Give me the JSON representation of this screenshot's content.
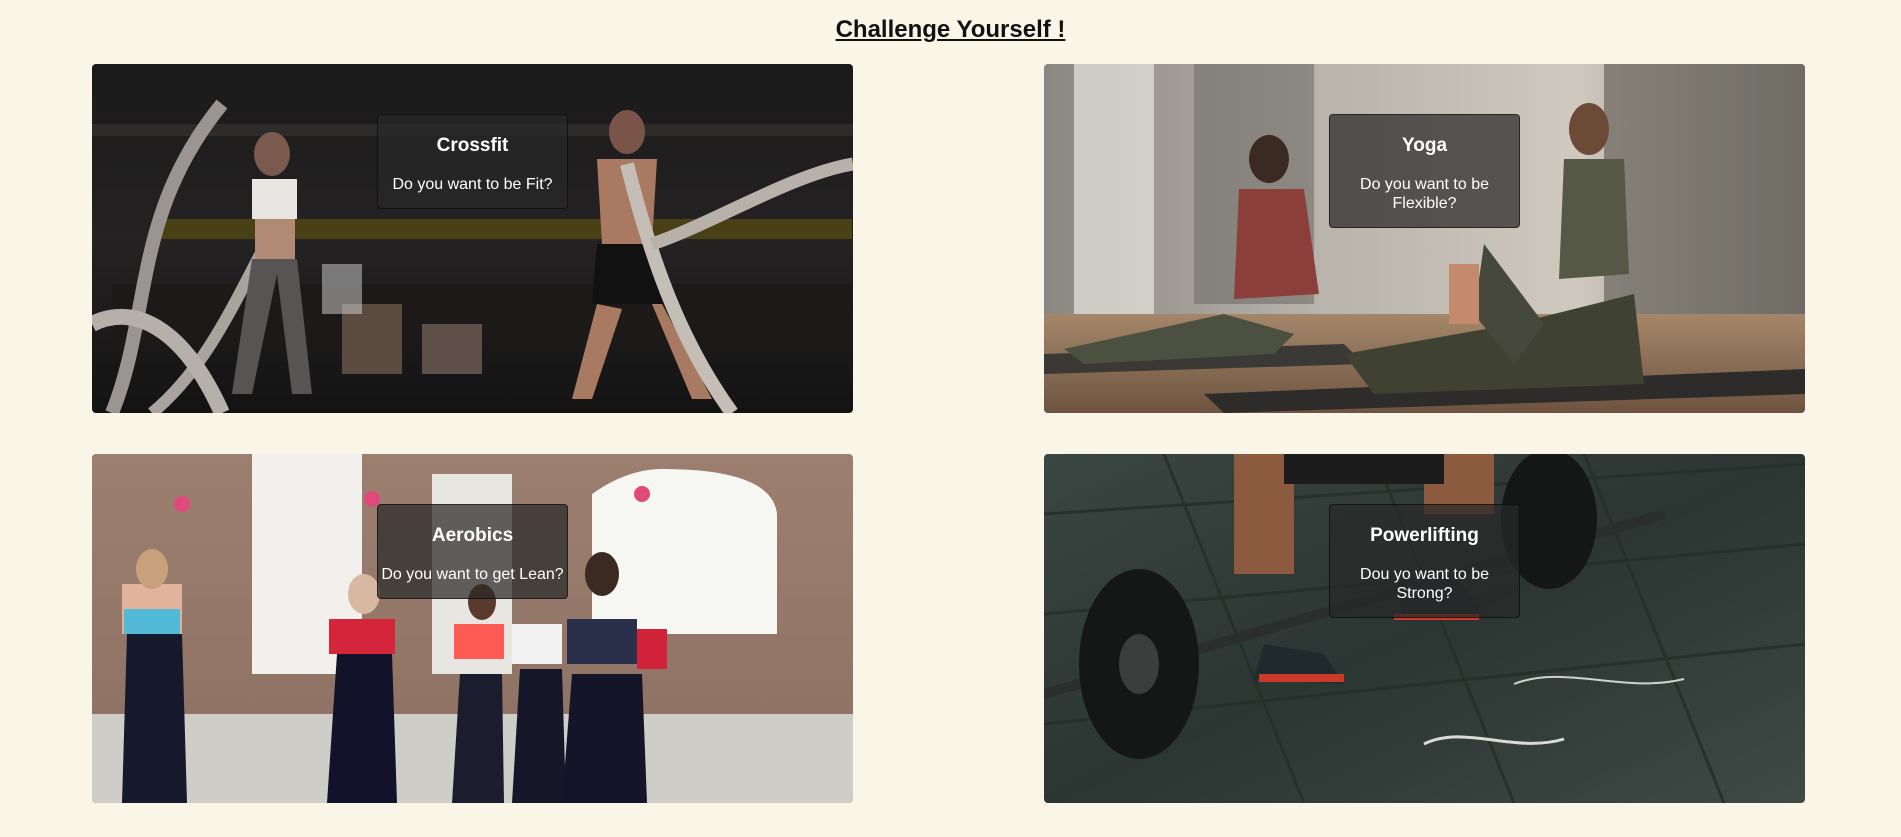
{
  "page": {
    "title": "Challenge Yourself !",
    "background": "#f9f6e8"
  },
  "cards": [
    {
      "id": "crossfit",
      "title": "Crossfit",
      "subtitle": "Do you want to be Fit?",
      "photo": "two athletes training with battle ropes in a dark gym"
    },
    {
      "id": "yoga",
      "title": "Yoga",
      "subtitle": "Do you want to be Flexible?",
      "photo": "two women stretching on yoga mats in a sunlit studio"
    },
    {
      "id": "aerobics",
      "title": "Aerobics",
      "subtitle": "Do you want to get Lean?",
      "photo": "group of women lifting pink dumbbells in a brick-walled room"
    },
    {
      "id": "powerlifting",
      "title": "Powerlifting",
      "subtitle": "Dou yo want to be Strong?",
      "photo": "lifter gripping a loaded barbell on a dark rubber floor"
    }
  ]
}
